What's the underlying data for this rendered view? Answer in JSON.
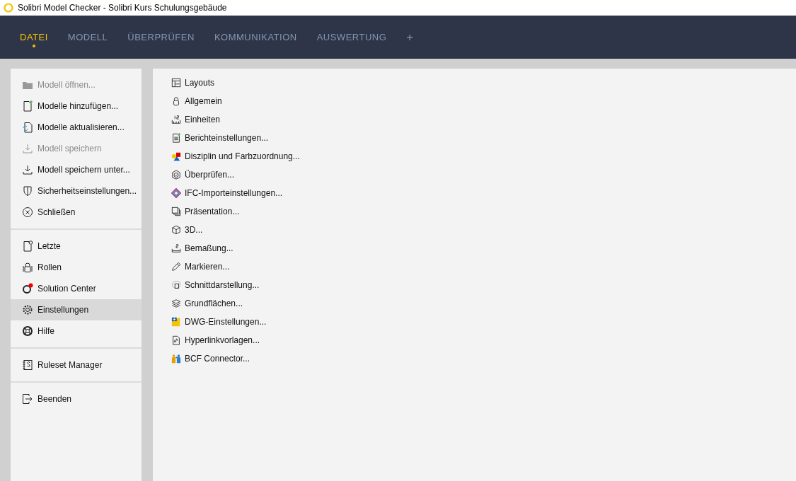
{
  "window": {
    "title": "Solibri Model Checker - Solibri Kurs Schulungsgebäude"
  },
  "tabs": [
    {
      "label": "DATEI",
      "selected": true
    },
    {
      "label": "MODELL",
      "selected": false
    },
    {
      "label": "ÜBERPRÜFEN",
      "selected": false
    },
    {
      "label": "KOMMUNIKATION",
      "selected": false
    },
    {
      "label": "AUSWERTUNG",
      "selected": false
    },
    {
      "label": "+",
      "selected": false
    }
  ],
  "sidebar": {
    "groups": [
      {
        "items": [
          {
            "label": "Modell öffnen...",
            "disabled": true,
            "selected": false
          },
          {
            "label": "Modelle hinzufügen...",
            "disabled": false,
            "selected": false
          },
          {
            "label": "Modelle aktualisieren...",
            "disabled": false,
            "selected": false
          },
          {
            "label": "Modell speichern",
            "disabled": true,
            "selected": false
          },
          {
            "label": "Modell speichern unter...",
            "disabled": false,
            "selected": false
          },
          {
            "label": "Sicherheitseinstellungen...",
            "disabled": false,
            "selected": false
          },
          {
            "label": "Schließen",
            "disabled": false,
            "selected": false
          }
        ]
      },
      {
        "items": [
          {
            "label": "Letzte",
            "disabled": false,
            "selected": false
          },
          {
            "label": "Rollen",
            "disabled": false,
            "selected": false
          },
          {
            "label": "Solution Center",
            "disabled": false,
            "selected": false
          },
          {
            "label": "Einstellungen",
            "disabled": false,
            "selected": true
          },
          {
            "label": "Hilfe",
            "disabled": false,
            "selected": false
          }
        ]
      },
      {
        "items": [
          {
            "label": "Ruleset Manager",
            "disabled": false,
            "selected": false
          }
        ]
      },
      {
        "items": [
          {
            "label": "Beenden",
            "disabled": false,
            "selected": false
          }
        ]
      }
    ]
  },
  "settings": {
    "items": [
      "Layouts",
      "Allgemein",
      "Einheiten",
      "Berichteinstellungen...",
      "Disziplin und Farbzuordnung...",
      "Überprüfen...",
      "IFC-Importeinstellungen...",
      "Präsentation...",
      "3D...",
      "Bemaßung...",
      "Markieren...",
      "Schnittdarstellung...",
      "Grundflächen...",
      "DWG-Einstellungen...",
      "Hyperlinkvorlagen...",
      "BCF Connector..."
    ]
  }
}
